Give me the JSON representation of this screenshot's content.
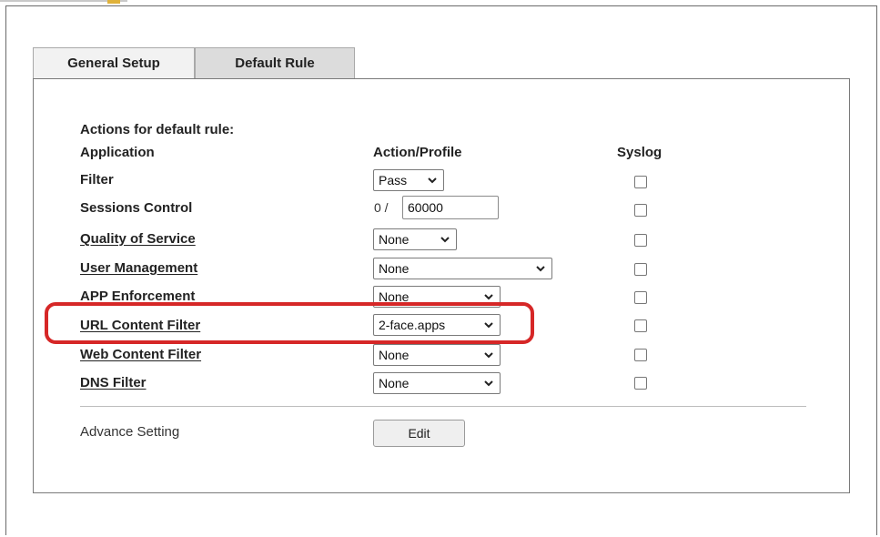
{
  "tabs": [
    {
      "label": "General Setup",
      "active": false
    },
    {
      "label": "Default Rule",
      "active": true
    }
  ],
  "section_title": "Actions for default rule:",
  "columns": {
    "application": "Application",
    "action_profile": "Action/Profile",
    "syslog": "Syslog"
  },
  "rows": {
    "filter": {
      "label": "Filter",
      "value": "Pass",
      "syslog": false
    },
    "sessions_control": {
      "label": "Sessions Control",
      "prefix": "0 /",
      "value": "60000",
      "syslog": false
    },
    "qos": {
      "label": "Quality of Service",
      "value": "None",
      "syslog": false
    },
    "user_mgmt": {
      "label": "User Management",
      "value": "None",
      "syslog": false
    },
    "app_enforcement": {
      "label": "APP Enforcement",
      "value": "None",
      "syslog": false
    },
    "url_filter": {
      "label": "URL Content Filter",
      "value": "2-face.apps",
      "syslog": false
    },
    "web_filter": {
      "label": "Web Content Filter",
      "value": "None",
      "syslog": false
    },
    "dns_filter": {
      "label": "DNS Filter",
      "value": "None",
      "syslog": false
    }
  },
  "advance_setting": {
    "label": "Advance Setting",
    "button": "Edit"
  },
  "colors": {
    "highlight": "#d62727",
    "active_tab": "#dcdcdc",
    "inactive_tab": "#f2f2f2"
  }
}
